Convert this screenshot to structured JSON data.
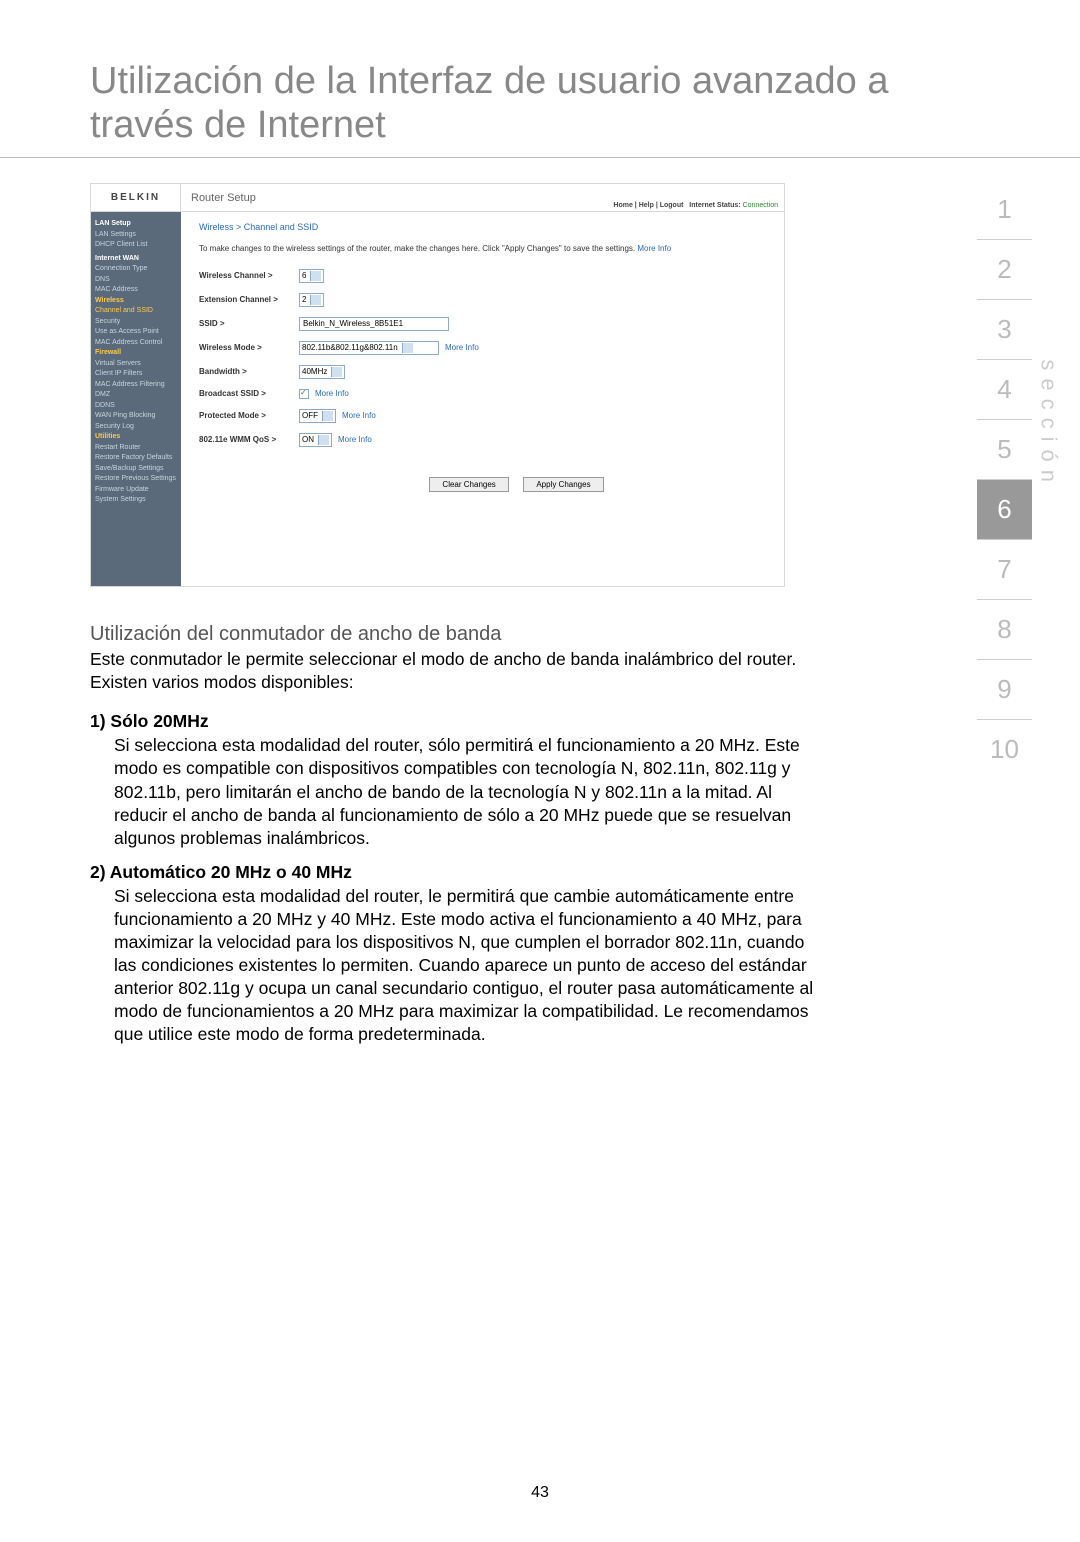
{
  "title": "Utilización de la Interfaz de usuario avanzado a través de Internet",
  "tabs": [
    "1",
    "2",
    "3",
    "4",
    "5",
    "6",
    "7",
    "8",
    "9",
    "10"
  ],
  "active_tab_index": 5,
  "section_label": "sección",
  "router": {
    "logo": "BELKIN",
    "setup_title": "Router Setup",
    "meta_links": "Home | Help | Logout",
    "meta_status_label": "Internet Status:",
    "meta_status_value": "Connection",
    "sidebar": {
      "groups": [
        {
          "cat": "LAN Setup",
          "items": [
            "LAN Settings",
            "DHCP Client List"
          ]
        },
        {
          "cat": "Internet WAN",
          "items": [
            "Connection Type",
            "DNS",
            "MAC Address"
          ]
        },
        {
          "cat_hl": "Wireless",
          "items_hl_first": "Channel and SSID",
          "items": [
            "Security",
            "Use as Access Point",
            "MAC Address Control"
          ]
        },
        {
          "cat_hl": "Firewall",
          "items": [
            "Virtual Servers",
            "Client IP Filters",
            "MAC Address Filtering",
            "DMZ",
            "DDNS",
            "WAN Ping Blocking",
            "Security Log"
          ]
        },
        {
          "cat_hl": "Utilities",
          "items": [
            "Restart Router",
            "Restore Factory Defaults",
            "Save/Backup Settings",
            "Restore Previous Settings",
            "Firmware Update",
            "System Settings"
          ]
        }
      ]
    },
    "breadcrumb": "Wireless > Channel and SSID",
    "instructions": "To make changes to the wireless settings of the router, make the changes here. Click \"Apply Changes\" to save the settings.",
    "more_info": "More Info",
    "fields": {
      "wireless_channel": {
        "label": "Wireless Channel >",
        "value": "6"
      },
      "extension_channel": {
        "label": "Extension Channel >",
        "value": "2"
      },
      "ssid": {
        "label": "SSID >",
        "value": "Belkin_N_Wireless_8B51E1"
      },
      "wireless_mode": {
        "label": "Wireless Mode >",
        "value": "802.11b&802.11g&802.11n"
      },
      "bandwidth": {
        "label": "Bandwidth >",
        "value": "40MHz"
      },
      "broadcast_ssid": {
        "label": "Broadcast SSID >"
      },
      "protected_mode": {
        "label": "Protected Mode >",
        "value": "OFF"
      },
      "wmm_qos": {
        "label": "802.11e WMM QoS >",
        "value": "ON"
      }
    },
    "buttons": {
      "clear": "Clear Changes",
      "apply": "Apply Changes"
    }
  },
  "body": {
    "subhead": "Utilización del conmutador de ancho de banda",
    "intro": "Este conmutador le permite seleccionar el modo de ancho de banda inalámbrico del router. Existen varios modos disponibles:",
    "opt1_label": "1)  Sólo 20MHz",
    "opt1_text": "Si selecciona esta modalidad del router, sólo permitirá el funcionamiento a 20 MHz. Este modo es compatible con dispositivos compatibles con tecnología N, 802.11n, 802.11g y 802.11b, pero limitarán el ancho de bando de la tecnología N y 802.11n a la mitad. Al reducir el ancho de banda al funcionamiento de sólo a 20 MHz puede que se resuelvan algunos problemas inalámbricos.",
    "opt2_label": "2) Automático 20 MHz o 40 MHz",
    "opt2_text": "Si selecciona esta modalidad del router, le permitirá que cambie automáticamente entre funcionamiento a 20 MHz y 40 MHz. Este modo activa el funcionamiento a 40 MHz, para maximizar la velocidad para los dispositivos N, que cumplen el borrador 802.11n, cuando las condiciones existentes lo permiten. Cuando aparece un punto de acceso del estándar anterior 802.11g y ocupa un canal secundario contiguo, el router pasa automáticamente al modo de funcionamientos a 20 MHz para maximizar la compatibilidad. Le recomendamos que utilice este modo de forma predeterminada."
  },
  "pagenum": "43"
}
